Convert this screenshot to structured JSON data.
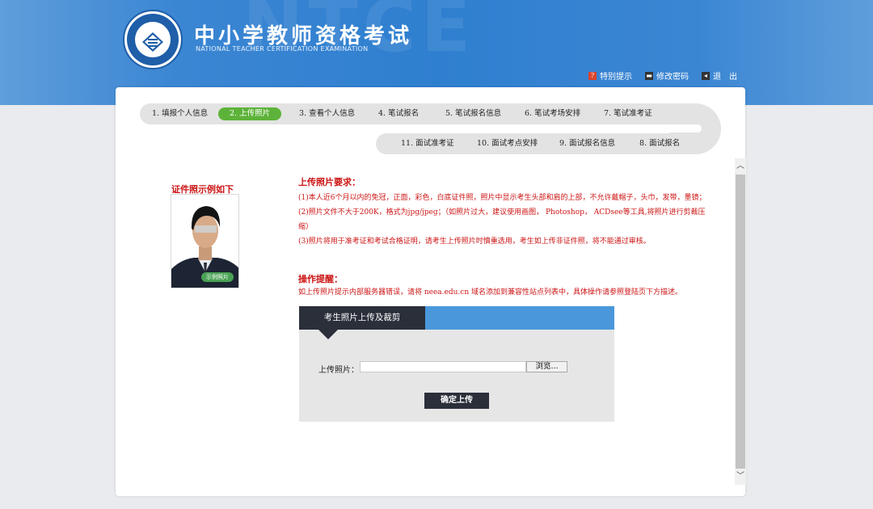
{
  "header": {
    "title": "中小学教师资格考试",
    "subtitle": "NATIONAL TEACHER CERTIFICATION EXAMINATION",
    "watermark": "NTCE",
    "links": [
      {
        "label": "特别提示",
        "icon": "notice-icon"
      },
      {
        "label": "修改密码",
        "icon": "password-icon"
      },
      {
        "label": "退　出",
        "icon": "logout-icon"
      }
    ]
  },
  "steps_row1": [
    "1. 填报个人信息",
    "2. 上传照片",
    "3. 查看个人信息",
    "4. 笔试报名",
    "5. 笔试报名信息",
    "6. 笔试考场安排",
    "7. 笔试准考证"
  ],
  "steps_row2": [
    "11. 面试准考证",
    "10. 面试考点安排",
    "9. 面试报名信息",
    "8. 面试报名"
  ],
  "active_step": "2. 上传照片",
  "example": {
    "title": "证件照示例如下",
    "badge": "示例照片"
  },
  "requirements": {
    "heading": "上传照片要求：",
    "lines": [
      "(1)本人近6个月以内的免冠，正面，彩色，白底证件照，照片中显示考生头部和肩的上部，不允许戴帽子，头巾，发带，墨镜；",
      "(2)照片文件不大于200K，格式为jpg/jpeg；（如照片过大，建议使用画图， Photoshop， ACDsee等工具,将照片进行剪裁压缩）",
      "(3)照片将用于准考证和考试合格证明，请考生上传照片时慎重选用，考生如上传非证件照，将不能通过审核。"
    ]
  },
  "operation": {
    "heading": "操作提醒：",
    "text": "如上传照片提示内部服务器错误，请将 neea.edu.cn 域名添加到兼容性站点列表中，具体操作请参照登陆页下方描述。"
  },
  "upload": {
    "tab_title": "考生照片上传及裁剪",
    "field_label": "上传照片：",
    "browse_label": "浏览...",
    "submit_label": "确定上传"
  },
  "colors": {
    "header_blue": "#2f7fd0",
    "active_step_green": "#5db33a",
    "text_red": "#cc1414",
    "panel_dark": "#2b2f3a",
    "panel_blue": "#4a98db"
  }
}
